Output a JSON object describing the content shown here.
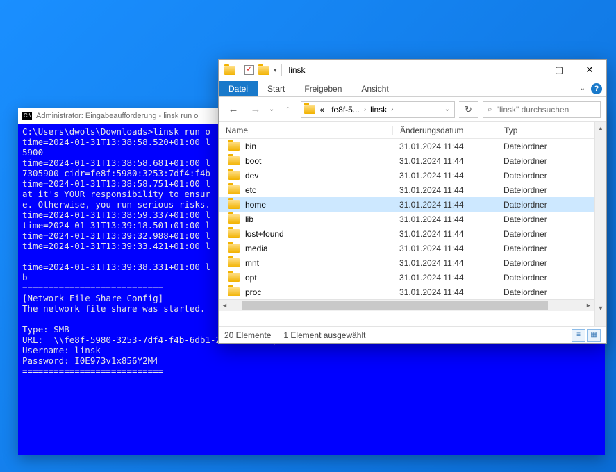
{
  "cmd": {
    "title": "Administrator: Eingabeaufforderung - linsk  run  o",
    "lines": [
      "C:\\Users\\dwols\\Downloads>linsk run o",
      "time=2024-01-31T13:38:58.520+01:00 l",
      "5900",
      "time=2024-01-31T13:38:58.681+01:00 l",
      "7305900 cidr=fe8f:5980:3253:7df4:f4b",
      "time=2024-01-31T13:38:58.751+01:00 l",
      "at it's YOUR responsibility to ensur",
      "e. Otherwise, you run serious risks.",
      "time=2024-01-31T13:38:59.337+01:00 l",
      "time=2024-01-31T13:39:18.501+01:00 l",
      "time=2024-01-31T13:39:32.988+01:00 l",
      "time=2024-01-31T13:39:33.421+01:00 l",
      "",
      "time=2024-01-31T13:39:38.331+01:00 l",
      "b",
      "===========================",
      "[Network File Share Config]",
      "The network file share was started.",
      "",
      "Type: SMB",
      "URL:  \\\\fe8f-5980-3253-7df4-f4b-6db1-2877-9f09.ipv6-literal.net\\linsk",
      "Username: linsk",
      "Password: I0E973v1x856Y2M4",
      "==========================="
    ]
  },
  "explorer": {
    "title": "linsk",
    "tabs": {
      "file": "Datei",
      "start": "Start",
      "share": "Freigeben",
      "view": "Ansicht"
    },
    "help": "?",
    "nav": {
      "back": "←",
      "fwd": "→",
      "up": "↑"
    },
    "breadcrumb": {
      "prefix": "«",
      "seg1": "fe8f-5...",
      "seg2": "linsk"
    },
    "refresh": "↻",
    "search": {
      "icon": "⌕",
      "placeholder": "\"linsk\" durchsuchen"
    },
    "columns": {
      "name": "Name",
      "date": "Änderungsdatum",
      "type": "Typ"
    },
    "rows": [
      {
        "name": "bin",
        "date": "31.01.2024 11:44",
        "type": "Dateiordner",
        "selected": false
      },
      {
        "name": "boot",
        "date": "31.01.2024 11:44",
        "type": "Dateiordner",
        "selected": false
      },
      {
        "name": "dev",
        "date": "31.01.2024 11:44",
        "type": "Dateiordner",
        "selected": false
      },
      {
        "name": "etc",
        "date": "31.01.2024 11:44",
        "type": "Dateiordner",
        "selected": false
      },
      {
        "name": "home",
        "date": "31.01.2024 11:44",
        "type": "Dateiordner",
        "selected": true
      },
      {
        "name": "lib",
        "date": "31.01.2024 11:44",
        "type": "Dateiordner",
        "selected": false
      },
      {
        "name": "lost+found",
        "date": "31.01.2024 11:44",
        "type": "Dateiordner",
        "selected": false
      },
      {
        "name": "media",
        "date": "31.01.2024 11:44",
        "type": "Dateiordner",
        "selected": false
      },
      {
        "name": "mnt",
        "date": "31.01.2024 11:44",
        "type": "Dateiordner",
        "selected": false
      },
      {
        "name": "opt",
        "date": "31.01.2024 11:44",
        "type": "Dateiordner",
        "selected": false
      },
      {
        "name": "proc",
        "date": "31.01.2024 11:44",
        "type": "Dateiordner",
        "selected": false
      }
    ],
    "status": {
      "count": "20 Elemente",
      "selected": "1 Element ausgewählt"
    },
    "winbtn": {
      "min": "—",
      "max": "▢",
      "close": "✕"
    }
  }
}
